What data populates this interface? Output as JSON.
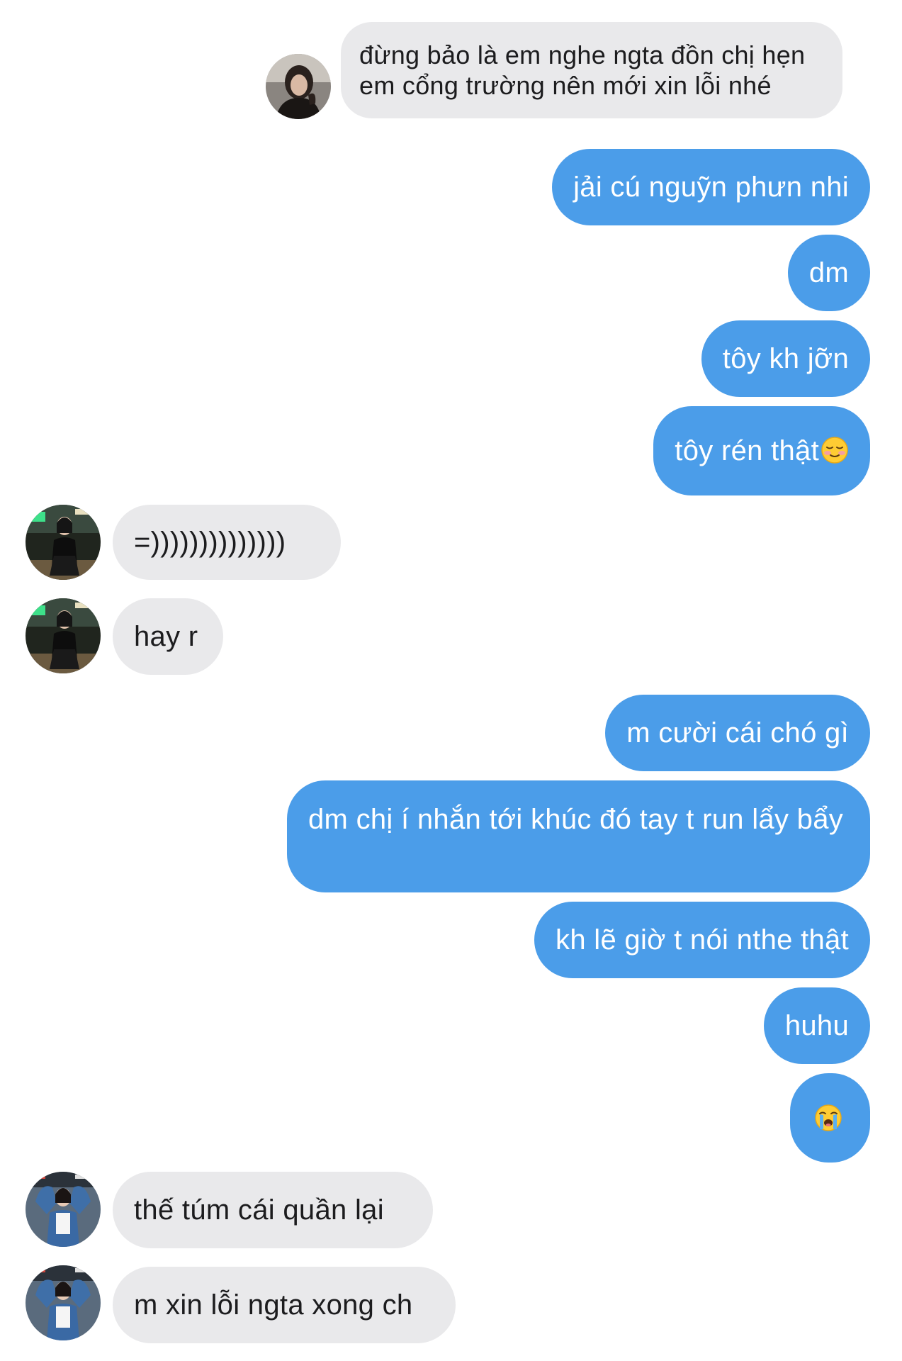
{
  "conversation": {
    "quoted_reply": "đừng bảo là em nghe ngta đồn chị hẹn em cổng trường nên mới xin lỗi nhé",
    "messages": [
      {
        "text": "jải cú nguỹn phưn nhi"
      },
      {
        "text": "dm"
      },
      {
        "text": "tôy kh jỡn"
      },
      {
        "text": "tôy rén thật",
        "emoji": "smiling-face-icon"
      },
      {
        "text": "=))))))))))))))"
      },
      {
        "text": "hay r"
      },
      {
        "text": "m cười cái chó gì"
      },
      {
        "text": "dm chị í nhắn tới khúc đó tay t run lẩy bẩy"
      },
      {
        "text": "kh lẽ giờ t nói nthe thật"
      },
      {
        "text": "huhu"
      },
      {
        "emoji": "loudly-crying-face-icon"
      },
      {
        "text": "thế túm cái quần lại"
      },
      {
        "text": "m xin lỗi ngta xong ch"
      }
    ]
  },
  "colors": {
    "outgoing_bubble": "#4b9de9",
    "incoming_bubble": "#e9e9eb",
    "incoming_text": "#1c1c1e",
    "outgoing_text": "#ffffff"
  }
}
